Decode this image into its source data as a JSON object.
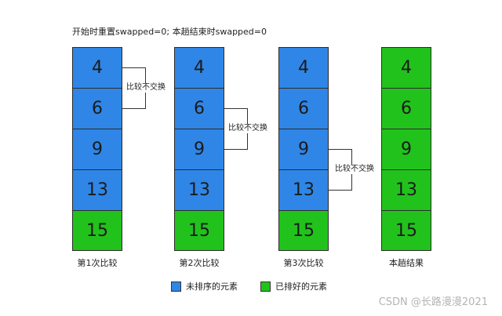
{
  "note": "开始时重置swapped=0; 本趟结束时swapped=0",
  "columns": [
    {
      "label": "第1次比较",
      "cells": [
        {
          "value": "4",
          "state": "unsorted"
        },
        {
          "value": "6",
          "state": "unsorted"
        },
        {
          "value": "9",
          "state": "unsorted"
        },
        {
          "value": "13",
          "state": "unsorted"
        },
        {
          "value": "15",
          "state": "sorted"
        }
      ]
    },
    {
      "label": "第2次比较",
      "cells": [
        {
          "value": "4",
          "state": "unsorted"
        },
        {
          "value": "6",
          "state": "unsorted"
        },
        {
          "value": "9",
          "state": "unsorted"
        },
        {
          "value": "13",
          "state": "unsorted"
        },
        {
          "value": "15",
          "state": "sorted"
        }
      ]
    },
    {
      "label": "第3次比较",
      "cells": [
        {
          "value": "4",
          "state": "unsorted"
        },
        {
          "value": "6",
          "state": "unsorted"
        },
        {
          "value": "9",
          "state": "unsorted"
        },
        {
          "value": "13",
          "state": "unsorted"
        },
        {
          "value": "15",
          "state": "sorted"
        }
      ]
    },
    {
      "label": "本趟结果",
      "cells": [
        {
          "value": "4",
          "state": "sorted"
        },
        {
          "value": "6",
          "state": "sorted"
        },
        {
          "value": "9",
          "state": "sorted"
        },
        {
          "value": "13",
          "state": "sorted"
        },
        {
          "value": "15",
          "state": "sorted"
        }
      ]
    }
  ],
  "comparisons": [
    {
      "label": "比较不交换"
    },
    {
      "label": "比较不交换"
    },
    {
      "label": "比较不交换"
    }
  ],
  "legend": {
    "unsorted": "未排序的元素",
    "sorted": "已排好的元素"
  },
  "colors": {
    "unsorted": "#2f86e6",
    "sorted": "#22c21c"
  },
  "watermark": "CSDN @长路漫漫2021"
}
